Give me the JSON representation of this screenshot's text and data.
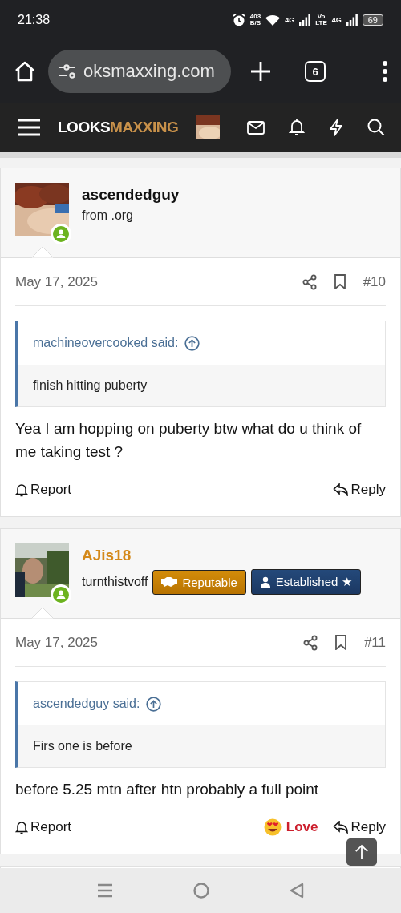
{
  "status_bar": {
    "time": "21:38",
    "speed": "403",
    "speed_unit": "B/S",
    "network_1": "4G",
    "volte_top": "Vo",
    "volte_bottom": "LTE",
    "network_2": "4G",
    "battery": "69"
  },
  "browser": {
    "url": "oksmaxxing.com",
    "tab_count": "6"
  },
  "site_nav": {
    "logo_first": "LOOKS",
    "logo_second": "MAXXING"
  },
  "posts": [
    {
      "author": {
        "name": "ascendedguy",
        "color": "#111111",
        "title": "from .org",
        "online": true
      },
      "date": "May 17, 2025",
      "number": "#10",
      "quote": {
        "author": "machineovercooked said:",
        "text": "finish hitting puberty"
      },
      "message": "Yea I am hopping on puberty btw what do u think of me taking test ?",
      "actions": {
        "report": "Report",
        "reply": "Reply"
      }
    },
    {
      "author": {
        "name": "AJis18",
        "color": "#d4891a",
        "title": "turnthistvoff",
        "online": true,
        "badges": [
          {
            "kind": "reputable",
            "label": "Reputable"
          },
          {
            "kind": "established",
            "label": "Established ★"
          }
        ]
      },
      "date": "May 17, 2025",
      "number": "#11",
      "quote": {
        "author": "ascendedguy said:",
        "text": "Firs one is before"
      },
      "message": "before 5.25 mtn after htn probably a full point",
      "actions": {
        "report": "Report",
        "reaction": "Love",
        "reply": "Reply"
      }
    }
  ]
}
